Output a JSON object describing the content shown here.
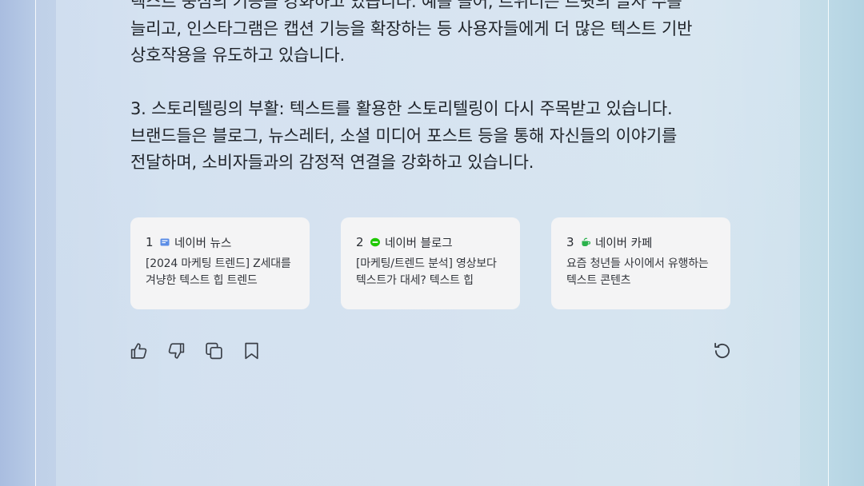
{
  "answer": {
    "paragraphs": [
      "텍스트 중심의 기능을 강화하고 있습니다. 예를 들어, 트위터는 트윗의 글자 수를\n늘리고, 인스타그램은 캡션 기능을 확장하는 등 사용자들에게 더 많은 텍스트 기반\n상호작용을 유도하고 있습니다.",
      "3. 스토리텔링의 부활: 텍스트를 활용한 스토리텔링이 다시 주목받고 있습니다.\n브랜드들은 블로그, 뉴스레터, 소셜 미디어 포스트 등을 통해 자신들의 이야기를\n전달하며, 소비자들과의 감정적 연결을 강화하고 있습니다."
    ]
  },
  "sources": [
    {
      "number": "1",
      "site": "네이버 뉴스",
      "icon": "naver-news-icon",
      "icon_color": "#5b8de6",
      "title": "[2024 마케팅 트렌드] Z세대를\n겨냥한 텍스트 힙 트렌드"
    },
    {
      "number": "2",
      "site": "네이버 블로그",
      "icon": "naver-blog-icon",
      "icon_color": "#1ec800",
      "title": "[마케팅/트렌드 분석] 영상보다\n텍스트가 대세? 텍스트 힙"
    },
    {
      "number": "3",
      "site": "네이버 카페",
      "icon": "naver-cafe-icon",
      "icon_color": "#2bb24c",
      "title": "요즘 청년들 사이에서 유행하는\n텍스트 콘텐츠"
    }
  ],
  "actions": {
    "like": "thumbs-up-icon",
    "dislike": "thumbs-down-icon",
    "copy": "copy-icon",
    "save": "bookmark-icon",
    "regenerate": "refresh-icon"
  }
}
